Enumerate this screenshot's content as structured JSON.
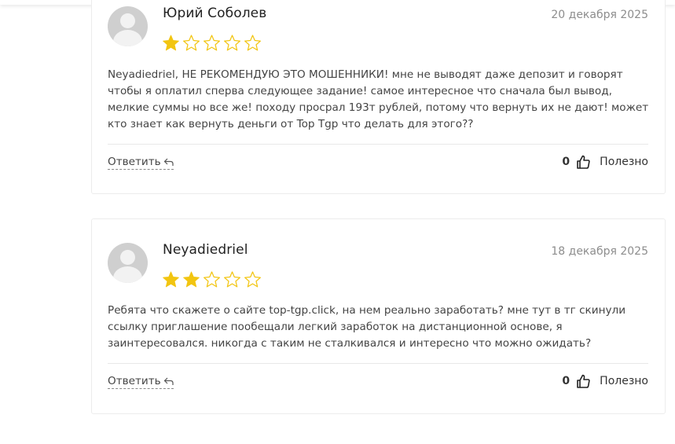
{
  "reviews": [
    {
      "author": "Юрий Соболев",
      "date": "20 декабря 2025",
      "rating": 1,
      "max_rating": 5,
      "text": "Neyadiedriel, НЕ РЕКОМЕНДУЮ ЭТО МОШЕННИКИ! мне не выводят даже депозит и говорят чтобы я оплатил сперва следующее задание! самое интересное что сначала был вывод, мелкие суммы но все же! походу просрал 193т рублей, потому что вернуть их не дают! может кто знает как вернуть деньги от Top Tgp что делать для этого??",
      "reply_label": "Ответить",
      "helpful_count": "0",
      "helpful_label": "Полезно"
    },
    {
      "author": "Neyadiedriel",
      "date": "18 декабря 2025",
      "rating": 2,
      "max_rating": 5,
      "text": "Ребята что скажете о сайте top-tgp.click, на нем реально заработать? мне тут в тг скинули ссылку приглашение пообещали легкий заработок на дистанционной основе, я заинтересовался. никогда с таким не сталкивался и интересно что можно ожидать?",
      "reply_label": "Ответить",
      "helpful_count": "0",
      "helpful_label": "Полезно"
    }
  ],
  "colors": {
    "star_filled": "#f2c511",
    "star_empty_outline": "#f2c511",
    "card_border": "#ececec",
    "avatar_bg": "#cfcfcf"
  },
  "icons": {
    "star": "star-icon",
    "reply": "reply-arrow-icon",
    "thumb": "thumbs-up-icon",
    "avatar": "user-avatar-icon"
  }
}
